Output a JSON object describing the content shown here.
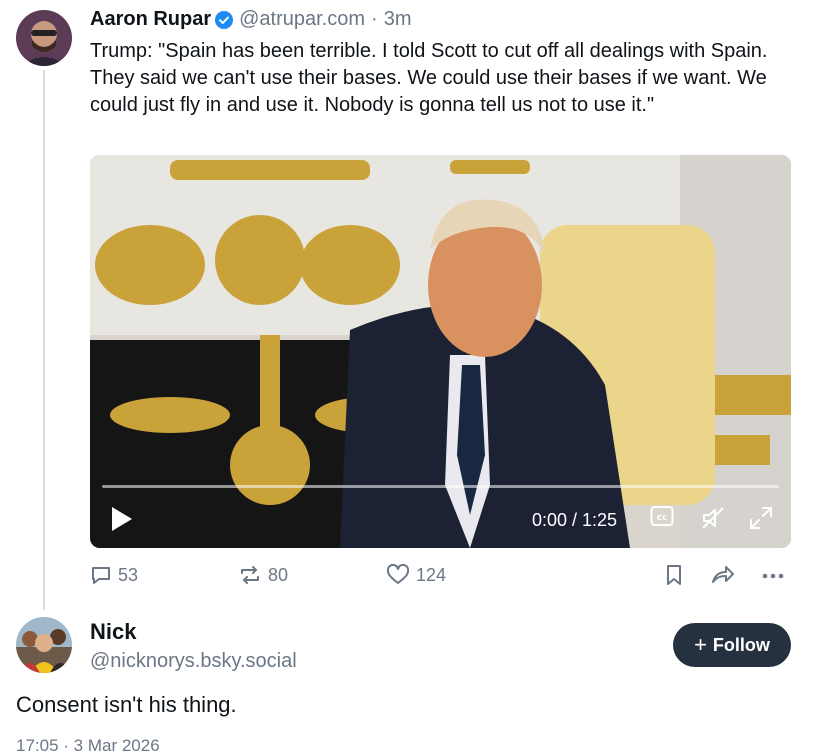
{
  "post": {
    "author_name": "Aaron Rupar",
    "author_handle": "@atrupar.com",
    "separator": "·",
    "time_ago": "3m",
    "text": "Trump: \"Spain has been terrible. I told Scott to cut off all dealings with Spain. They said we can't use their bases. We could use their bases if we want. We could just fly in and use it. Nobody is gonna tell us not to use it.\"",
    "video": {
      "time_display": "0:00 / 1:25",
      "progress": 0,
      "controls": [
        "play-icon",
        "captions-icon",
        "mute-icon",
        "fullscreen-icon"
      ]
    },
    "actions": {
      "replies": "53",
      "reposts": "80",
      "likes": "124"
    }
  },
  "reply": {
    "author_name": "Nick",
    "author_handle": "@nicknorys.bsky.social",
    "follow_label": "Follow",
    "text": "Consent isn't his thing.",
    "date": "17:05 · 3 Mar 2026"
  },
  "colors": {
    "muted": "#6b7785",
    "follow_bg": "#263140",
    "verified": "#1d8cf0"
  }
}
